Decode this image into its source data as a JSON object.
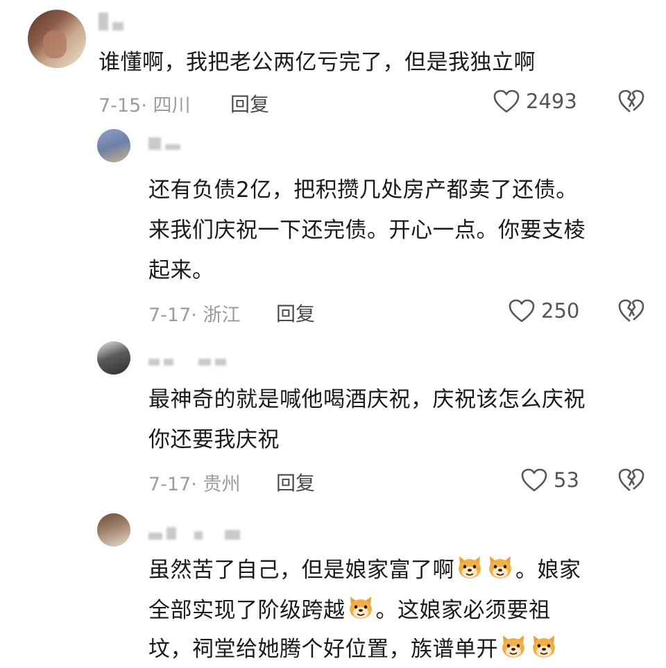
{
  "comments": [
    {
      "text": "谁懂啊，我把老公两亿亏完了，但是我独立啊",
      "meta": "7-15· 四川",
      "reply": "回复",
      "likes": "2493"
    },
    {
      "text_lines": [
        "还有负债2亿，把积攒几处房产都卖了还债。",
        "来我们庆祝一下还完债。开心一点。你要支棱",
        "起来。"
      ],
      "meta": "7-17· 浙江",
      "reply": "回复",
      "likes": "250"
    },
    {
      "text_lines": [
        "最神奇的就是喊他喝酒庆祝，庆祝该怎么庆祝",
        "你还要我庆祝"
      ],
      "meta": "7-17· 贵州",
      "reply": "回复",
      "likes": "53"
    },
    {
      "line1_a": "虽然苦了自己，但是娘家富了啊",
      "line1_b": "。娘家",
      "line2_a": "全部实现了阶级跨越",
      "line2_b": "。这娘家必须要祖",
      "line3": "坟，祠堂给她腾个好位置，族谱单开"
    }
  ],
  "icons": {
    "like": "heart-outline-icon",
    "dislike": "broken-heart-icon",
    "emoji": "doge-emoji-icon"
  },
  "colors": {
    "text": "#1a1a1a",
    "meta": "#9c9c9c",
    "reply": "#4a4a4a"
  }
}
